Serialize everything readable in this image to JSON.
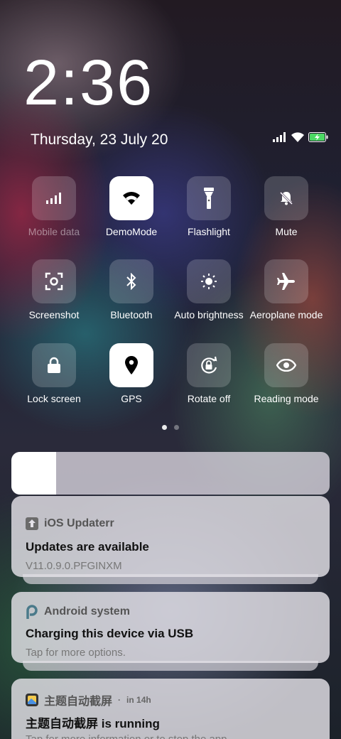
{
  "clock": {
    "time": "2:36",
    "date": "Thursday, 23 July 20"
  },
  "status_bar": {
    "icons": [
      "signal-icon",
      "wifi-icon",
      "battery-charging-icon"
    ]
  },
  "quick_settings": [
    {
      "label": "Mobile data",
      "icon": "mobile-data-icon",
      "active": false,
      "disabled": true
    },
    {
      "label": "DemoMode",
      "icon": "wifi-icon",
      "active": true,
      "disabled": false
    },
    {
      "label": "Flashlight",
      "icon": "flashlight-icon",
      "active": false,
      "disabled": false
    },
    {
      "label": "Mute",
      "icon": "mute-bell-icon",
      "active": false,
      "disabled": false
    },
    {
      "label": "Screenshot",
      "icon": "screenshot-icon",
      "active": false,
      "disabled": false
    },
    {
      "label": "Bluetooth",
      "icon": "bluetooth-icon",
      "active": false,
      "disabled": false
    },
    {
      "label": "Auto brightness",
      "icon": "brightness-icon",
      "active": false,
      "disabled": false
    },
    {
      "label": "Aeroplane mode",
      "icon": "aeroplane-icon",
      "active": false,
      "disabled": false
    },
    {
      "label": "Lock screen",
      "icon": "lock-icon",
      "active": false,
      "disabled": false
    },
    {
      "label": "GPS",
      "icon": "location-pin-icon",
      "active": true,
      "disabled": false
    },
    {
      "label": "Rotate off",
      "icon": "rotate-lock-icon",
      "active": false,
      "disabled": false
    },
    {
      "label": "Reading mode",
      "icon": "eye-icon",
      "active": false,
      "disabled": false
    }
  ],
  "pager": {
    "pages": 2,
    "current": 1
  },
  "brightness": {
    "level": 0.14
  },
  "notifications": [
    {
      "app": "iOS Updaterr",
      "app_icon": "upload-arrow-icon",
      "time": "",
      "title": "Updates are available",
      "body": "V11.0.9.0.PFGINXM"
    },
    {
      "app": "Android system",
      "app_icon": "android-p-icon",
      "time": "",
      "title": "Charging this device via USB",
      "body": "Tap for more options."
    },
    {
      "app": "主题自动截屏",
      "app_icon": "screenshot-app-icon",
      "time": "in 14h",
      "title": "主题自动截屏 is running",
      "body": "Tap for more information or to stop the app."
    }
  ],
  "colors": {
    "active_tile": "#ffffff",
    "battery": "#4cd964"
  }
}
